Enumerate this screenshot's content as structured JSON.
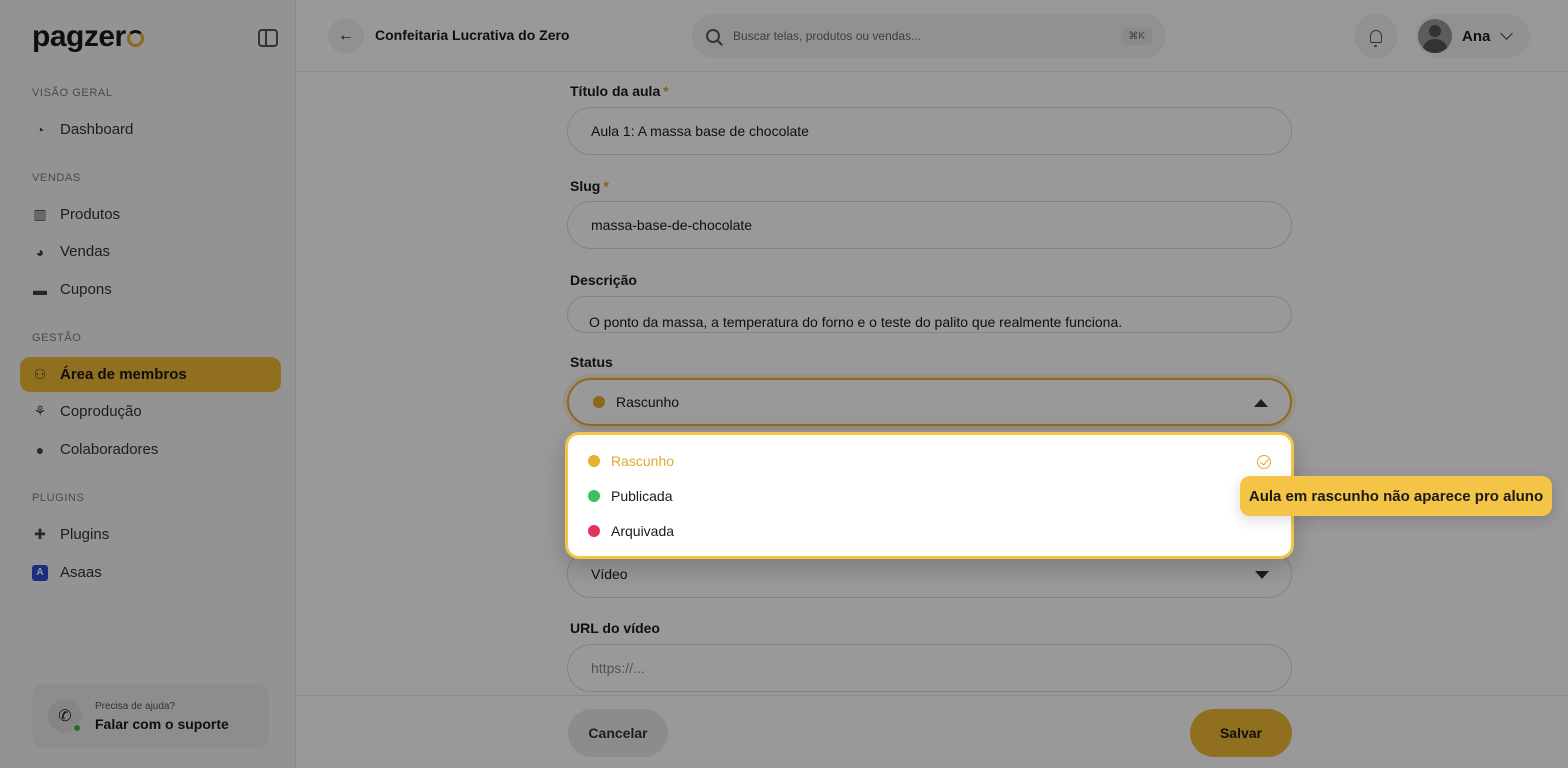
{
  "brand": {
    "logo_text": "pagzer",
    "logo_accent": "#f0b933"
  },
  "sidebar": {
    "sections": [
      {
        "label": "VISÃO GERAL"
      },
      {
        "label": "VENDAS"
      },
      {
        "label": "GESTÃO"
      },
      {
        "label": "PLUGINS"
      }
    ],
    "items": [
      {
        "label": "Dashboard",
        "icon": "dashboard-icon"
      },
      {
        "label": "Produtos",
        "icon": "products-icon"
      },
      {
        "label": "Vendas",
        "icon": "sales-icon"
      },
      {
        "label": "Cupons",
        "icon": "coupon-icon"
      },
      {
        "label": "Área de membros",
        "icon": "members-icon",
        "active": true
      },
      {
        "label": "Coprodução",
        "icon": "handshake-icon"
      },
      {
        "label": "Colaboradores",
        "icon": "user-icon"
      },
      {
        "label": "Plugins",
        "icon": "puzzle-icon"
      },
      {
        "label": "Asaas",
        "icon": "asaas-icon"
      }
    ],
    "help": {
      "small": "Precisa de ajuda?",
      "big": "Falar com o suporte"
    }
  },
  "header": {
    "title": "Confeitaria Lucrativa do Zero",
    "search_placeholder": "Buscar telas, produtos ou vendas...",
    "search_shortcut": "⌘K",
    "user_name": "Ana"
  },
  "form": {
    "title_label": "Título da aula",
    "title_value": "Aula 1: A massa base de chocolate",
    "slug_label": "Slug",
    "slug_value": "massa-base-de-chocolate",
    "required_mark": "*",
    "description_label": "Descrição",
    "description_value": "O ponto da massa, a temperatura do forno e o teste do palito que realmente funciona.",
    "status_label": "Status",
    "status_value": "Rascunho",
    "type_value": "Vídeo",
    "video_url_label": "URL do vídeo",
    "video_url_placeholder": "https://..."
  },
  "status_options": [
    {
      "label": "Rascunho",
      "color": "#e6b030",
      "selected": true
    },
    {
      "label": "Publicada",
      "color": "#3fbf63"
    },
    {
      "label": "Arquivada",
      "color": "#e0355f"
    }
  ],
  "tooltip": "Aula em rascunho não aparece pro aluno",
  "footer": {
    "cancel_label": "Cancelar",
    "save_label": "Salvar"
  }
}
